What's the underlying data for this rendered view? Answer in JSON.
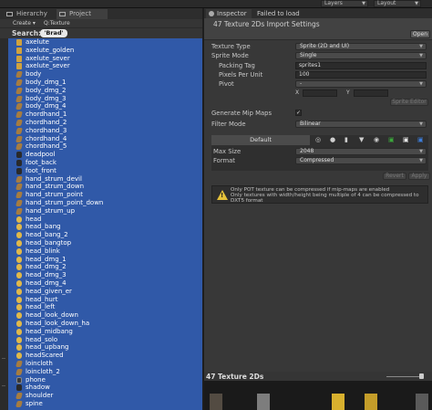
{
  "top": {
    "layers": "Layers",
    "layout": "Layout"
  },
  "left_panel": {
    "tabs": [
      {
        "label": "Hierarchy"
      },
      {
        "label": "Project"
      }
    ],
    "create": "Create ▾",
    "path": "Q:Texture",
    "search_label": "Search:",
    "search_value": "'Brad'",
    "items": [
      {
        "label": "axelute",
        "icon": "folder"
      },
      {
        "label": "axelute_golden",
        "icon": "folder"
      },
      {
        "label": "axelute_sever",
        "icon": "folder"
      },
      {
        "label": "axelute_sever",
        "icon": "folder"
      },
      {
        "label": "body",
        "icon": "prefab"
      },
      {
        "label": "body_dmg_1",
        "icon": "prefab"
      },
      {
        "label": "body_dmg_2",
        "icon": "prefab"
      },
      {
        "label": "body_dmg_3",
        "icon": "prefab"
      },
      {
        "label": "body_dmg_4",
        "icon": "prefab"
      },
      {
        "label": "chordhand_1",
        "icon": "prefab"
      },
      {
        "label": "chordhand_2",
        "icon": "prefab"
      },
      {
        "label": "chordhand_3",
        "icon": "prefab"
      },
      {
        "label": "chordhand_4",
        "icon": "prefab"
      },
      {
        "label": "chordhand_5",
        "icon": "prefab"
      },
      {
        "label": "deadpool",
        "icon": "dark"
      },
      {
        "label": "foot_back",
        "icon": "dark"
      },
      {
        "label": "foot_front",
        "icon": "dark"
      },
      {
        "label": "hand_strum_devil",
        "icon": "prefab"
      },
      {
        "label": "hand_strum_down",
        "icon": "prefab"
      },
      {
        "label": "hand_strum_point",
        "icon": "prefab"
      },
      {
        "label": "hand_strum_point_down",
        "icon": "prefab"
      },
      {
        "label": "hand_strum_up",
        "icon": "prefab"
      },
      {
        "label": "head",
        "icon": "gold"
      },
      {
        "label": "head_bang",
        "icon": "gold"
      },
      {
        "label": "head_bang_2",
        "icon": "gold"
      },
      {
        "label": "head_bangtop",
        "icon": "gold"
      },
      {
        "label": "head_blink",
        "icon": "gold"
      },
      {
        "label": "head_dmg_1",
        "icon": "gold"
      },
      {
        "label": "head_dmg_2",
        "icon": "gold"
      },
      {
        "label": "head_dmg_3",
        "icon": "gold"
      },
      {
        "label": "head_dmg_4",
        "icon": "gold"
      },
      {
        "label": "head_given_er",
        "icon": "gold"
      },
      {
        "label": "head_hurt",
        "icon": "gold"
      },
      {
        "label": "head_left",
        "icon": "gold"
      },
      {
        "label": "head_look_down",
        "icon": "gold"
      },
      {
        "label": "head_look_down_ha",
        "icon": "gold"
      },
      {
        "label": "head_midbang",
        "icon": "gold"
      },
      {
        "label": "head_solo",
        "icon": "gold"
      },
      {
        "label": "head_upbang",
        "icon": "gold"
      },
      {
        "label": "headScared",
        "icon": "gold"
      },
      {
        "label": "loincloth",
        "icon": "prefab"
      },
      {
        "label": "loincloth_2",
        "icon": "prefab"
      },
      {
        "label": "phone",
        "icon": "clip"
      },
      {
        "label": "shadow",
        "icon": "dark"
      },
      {
        "label": "shoulder",
        "icon": "prefab"
      },
      {
        "label": "spine",
        "icon": "prefab"
      }
    ]
  },
  "inspector": {
    "tabs": [
      {
        "label": "Inspector"
      },
      {
        "label": "Failed to load"
      }
    ],
    "title": "47 Texture 2Ds Import Settings",
    "open_btn": "Open",
    "texture_type_label": "Texture Type",
    "texture_type_value": "Sprite (2D and UI)",
    "sprite_mode_label": "Sprite Mode",
    "sprite_mode_value": "Single",
    "packing_tag_label": "Packing Tag",
    "packing_tag_value": "sprites1",
    "ppu_label": "Pixels Per Unit",
    "ppu_value": "100",
    "pivot_label": "Pivot",
    "pivot_value": "-",
    "x_label": "X",
    "y_label": "Y",
    "sprite_editor_btn": "Sprite Editor",
    "mipmaps_label": "Generate Mip Maps",
    "mipmaps_value": "✓",
    "filter_label": "Filter Mode",
    "filter_value": "Bilinear",
    "default_tab": "Default",
    "max_size_label": "Max Size",
    "max_size_value": "2048",
    "format_label": "Format",
    "format_value": "Compressed",
    "revert_btn": "Revert",
    "apply_btn": "Apply",
    "warning_text": "Only POT texture can be compressed if mip-maps are enabled\nOnly textures with width/height being multiple of 4 can be compressed to DXT5 format",
    "preview_title": "47 Texture 2Ds"
  },
  "colors": {
    "selection_blue": "#3059a8",
    "warning_yellow": "#e5c23a"
  },
  "icons": {
    "platform": [
      {
        "name": "standalone-icon",
        "glyph": "◎",
        "color": "#cfcfcf"
      },
      {
        "name": "webplayer-icon",
        "glyph": "●",
        "color": "#cfcfcf"
      },
      {
        "name": "ios-icon",
        "glyph": "▮",
        "color": "#cfcfcf"
      },
      {
        "name": "android-icon",
        "glyph": "▼",
        "color": "#cfcfcf"
      },
      {
        "name": "blackberry-icon",
        "glyph": "◉",
        "color": "#cfcfcf"
      },
      {
        "name": "windows-store-icon",
        "glyph": "▣",
        "color": "#3ba63b"
      },
      {
        "name": "webgl-icon",
        "glyph": "▣",
        "color": "#e8e8e8"
      },
      {
        "name": "html5-icon",
        "glyph": "▣",
        "color": "#3d7dd9"
      }
    ]
  }
}
